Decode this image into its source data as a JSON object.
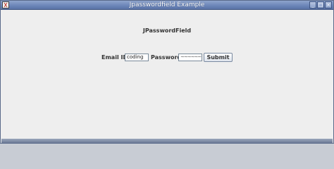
{
  "window": {
    "title": "Jpasswordfield Example",
    "minimize_glyph": "_",
    "maximize_glyph": "□",
    "close_glyph": "×"
  },
  "form": {
    "heading": "JPasswordField",
    "email_label": "Email ID:",
    "email_value": "coding",
    "password_label": "Password:",
    "password_mask": "~~~~~~",
    "submit_label": "Submit"
  },
  "icons": {
    "app": "java-app-icon",
    "minimize": "minimize-icon",
    "maximize": "maximize-icon",
    "close": "close-icon"
  },
  "colors": {
    "titlebar": "#6b85b8",
    "background": "#eeeeee",
    "text": "#333333"
  }
}
